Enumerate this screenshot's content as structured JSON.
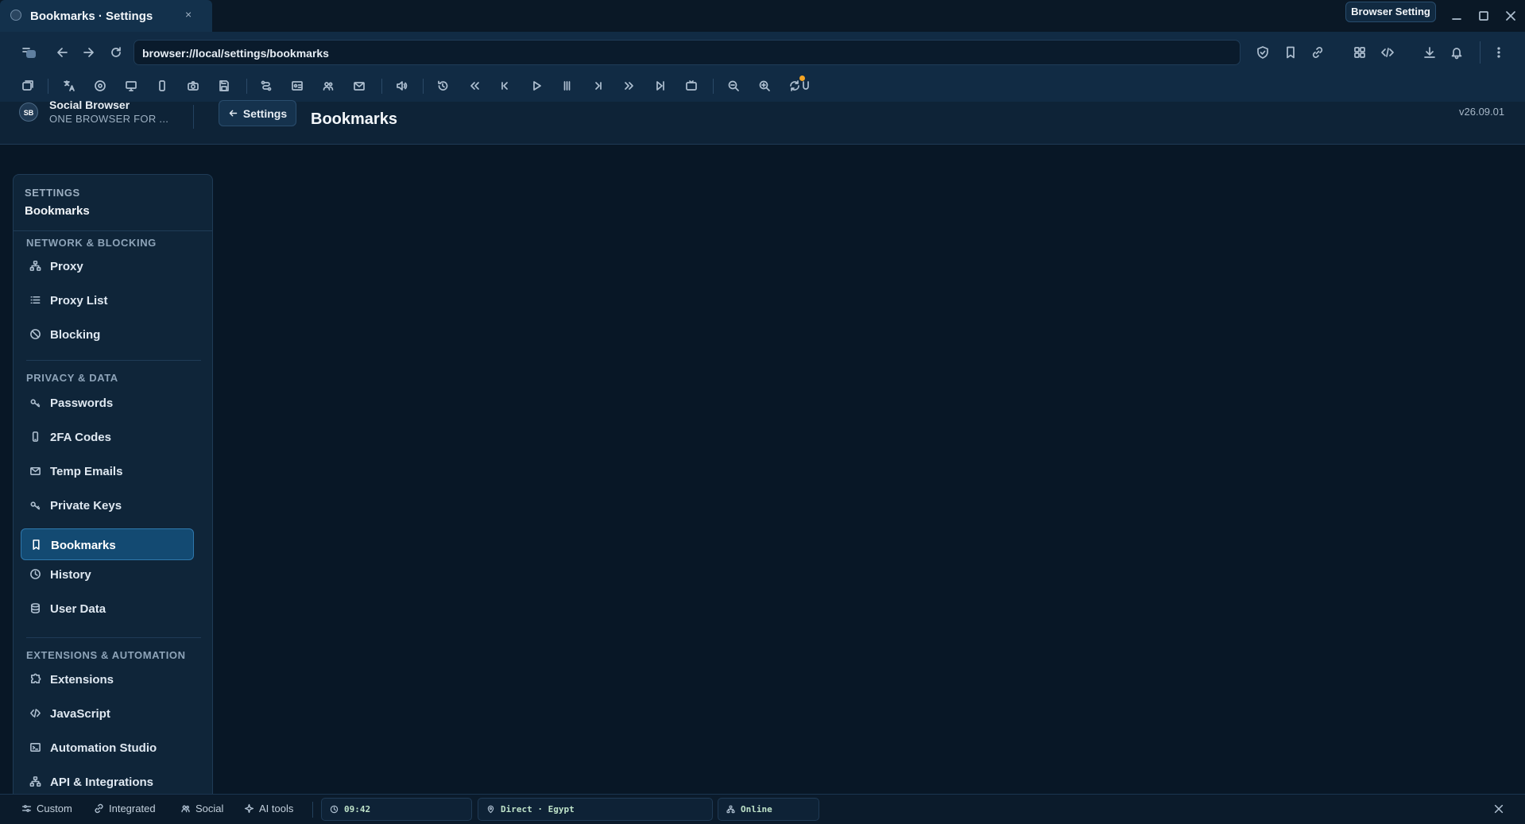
{
  "window": {
    "tab_title": "Bookmarks · Settings",
    "tab_close": "×",
    "browser_setting_button": "Browser Setting"
  },
  "nav": {
    "url": "browser://local/settings/bookmarks"
  },
  "header": {
    "logo_text": "SB",
    "brand_name": "Social Browser",
    "brand_tagline": "ONE BROWSER FOR ...",
    "back_button": "Settings",
    "page_title": "Bookmarks",
    "version": "v26.09.01"
  },
  "sidebar": {
    "eyebrow": "SETTINGS",
    "current": "Bookmarks",
    "sections": [
      {
        "title": "NETWORK & BLOCKING",
        "items": [
          {
            "label": "Proxy",
            "icon": "network-icon"
          },
          {
            "label": "Proxy List",
            "icon": "list-icon"
          },
          {
            "label": "Blocking",
            "icon": "block-icon"
          }
        ]
      },
      {
        "title": "PRIVACY & DATA",
        "items": [
          {
            "label": "Passwords",
            "icon": "key-icon"
          },
          {
            "label": "2FA Codes",
            "icon": "phone-icon"
          },
          {
            "label": "Temp Emails",
            "icon": "mail-icon"
          },
          {
            "label": "Private Keys",
            "icon": "key-icon"
          },
          {
            "label": "Bookmarks",
            "icon": "bookmark-icon",
            "active": true
          },
          {
            "label": "History",
            "icon": "clock-icon"
          },
          {
            "label": "User Data",
            "icon": "database-icon"
          }
        ]
      },
      {
        "title": "EXTENSIONS & AUTOMATION",
        "items": [
          {
            "label": "Extensions",
            "icon": "puzzle-icon"
          },
          {
            "label": "JavaScript",
            "icon": "code-icon"
          },
          {
            "label": "Automation Studio",
            "icon": "terminal-icon"
          },
          {
            "label": "API & Integrations",
            "icon": "network-icon"
          }
        ]
      }
    ]
  },
  "statusbar": {
    "custom": "Custom",
    "integrated": "Integrated",
    "social": "Social",
    "ai_tools": "AI tools",
    "time": "09:42",
    "connection": "Direct · Egypt",
    "status": "Online"
  },
  "colors": {
    "background": "#081726",
    "panel": "#0f2539",
    "toolbar": "#112b44",
    "active_item": "#134a72",
    "status_green": "#bfe3c9",
    "notification_dot": "#f5a524"
  }
}
